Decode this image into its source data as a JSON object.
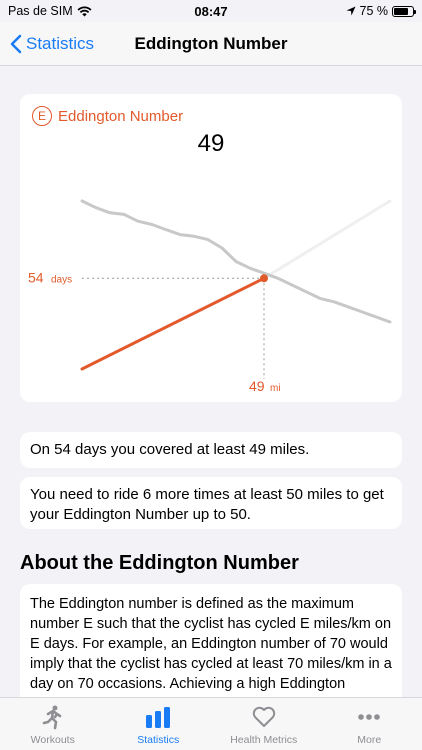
{
  "status": {
    "carrier": "Pas de SIM",
    "time": "08:47",
    "battery": "75 %"
  },
  "nav": {
    "back_label": "Statistics",
    "title": "Eddington Number"
  },
  "chart_card": {
    "title": "Eddington Number",
    "icon_letter": "E",
    "number": "49",
    "days_label_value": "54",
    "days_label_unit": "days",
    "miles_label_value": "49",
    "miles_label_unit": "mi",
    "accent": "#e25a2c"
  },
  "chart_data": {
    "type": "line",
    "series": [
      {
        "values": [
          0,
          54
        ],
        "color": "#e25a2c"
      },
      {
        "values": [
          54,
          100
        ],
        "color": "#efefef"
      },
      {
        "values": [
          100,
          96,
          93,
          92,
          88,
          86,
          83,
          80,
          79,
          77,
          72,
          64,
          60,
          57,
          54,
          50,
          46,
          42,
          40,
          37,
          34,
          31,
          28
        ],
        "color": "#c8c8c8"
      }
    ],
    "eddington": {
      "days": 54,
      "miles": 49
    }
  },
  "info": {
    "line1": "On 54 days you covered at least 49 miles.",
    "line2": "You need to ride 6 more times at least 50 miles to get your Eddington Number up to 50."
  },
  "about": {
    "title": "About the Eddington Number",
    "text": "The Eddington number is defined as the maximum number E such that the cyclist has cycled E miles/km on E days. For example, an Eddington number of 70 would imply that the cyclist has cycled at least 70 miles/km in a day on 70 occasions. Achieving a high Eddington number is difficult since moving from, say,"
  },
  "tabs": [
    {
      "label": "Workouts",
      "icon": "running-icon"
    },
    {
      "label": "Statistics",
      "icon": "bar-chart-icon"
    },
    {
      "label": "Health Metrics",
      "icon": "heart-icon"
    },
    {
      "label": "More",
      "icon": "more-icon"
    }
  ]
}
